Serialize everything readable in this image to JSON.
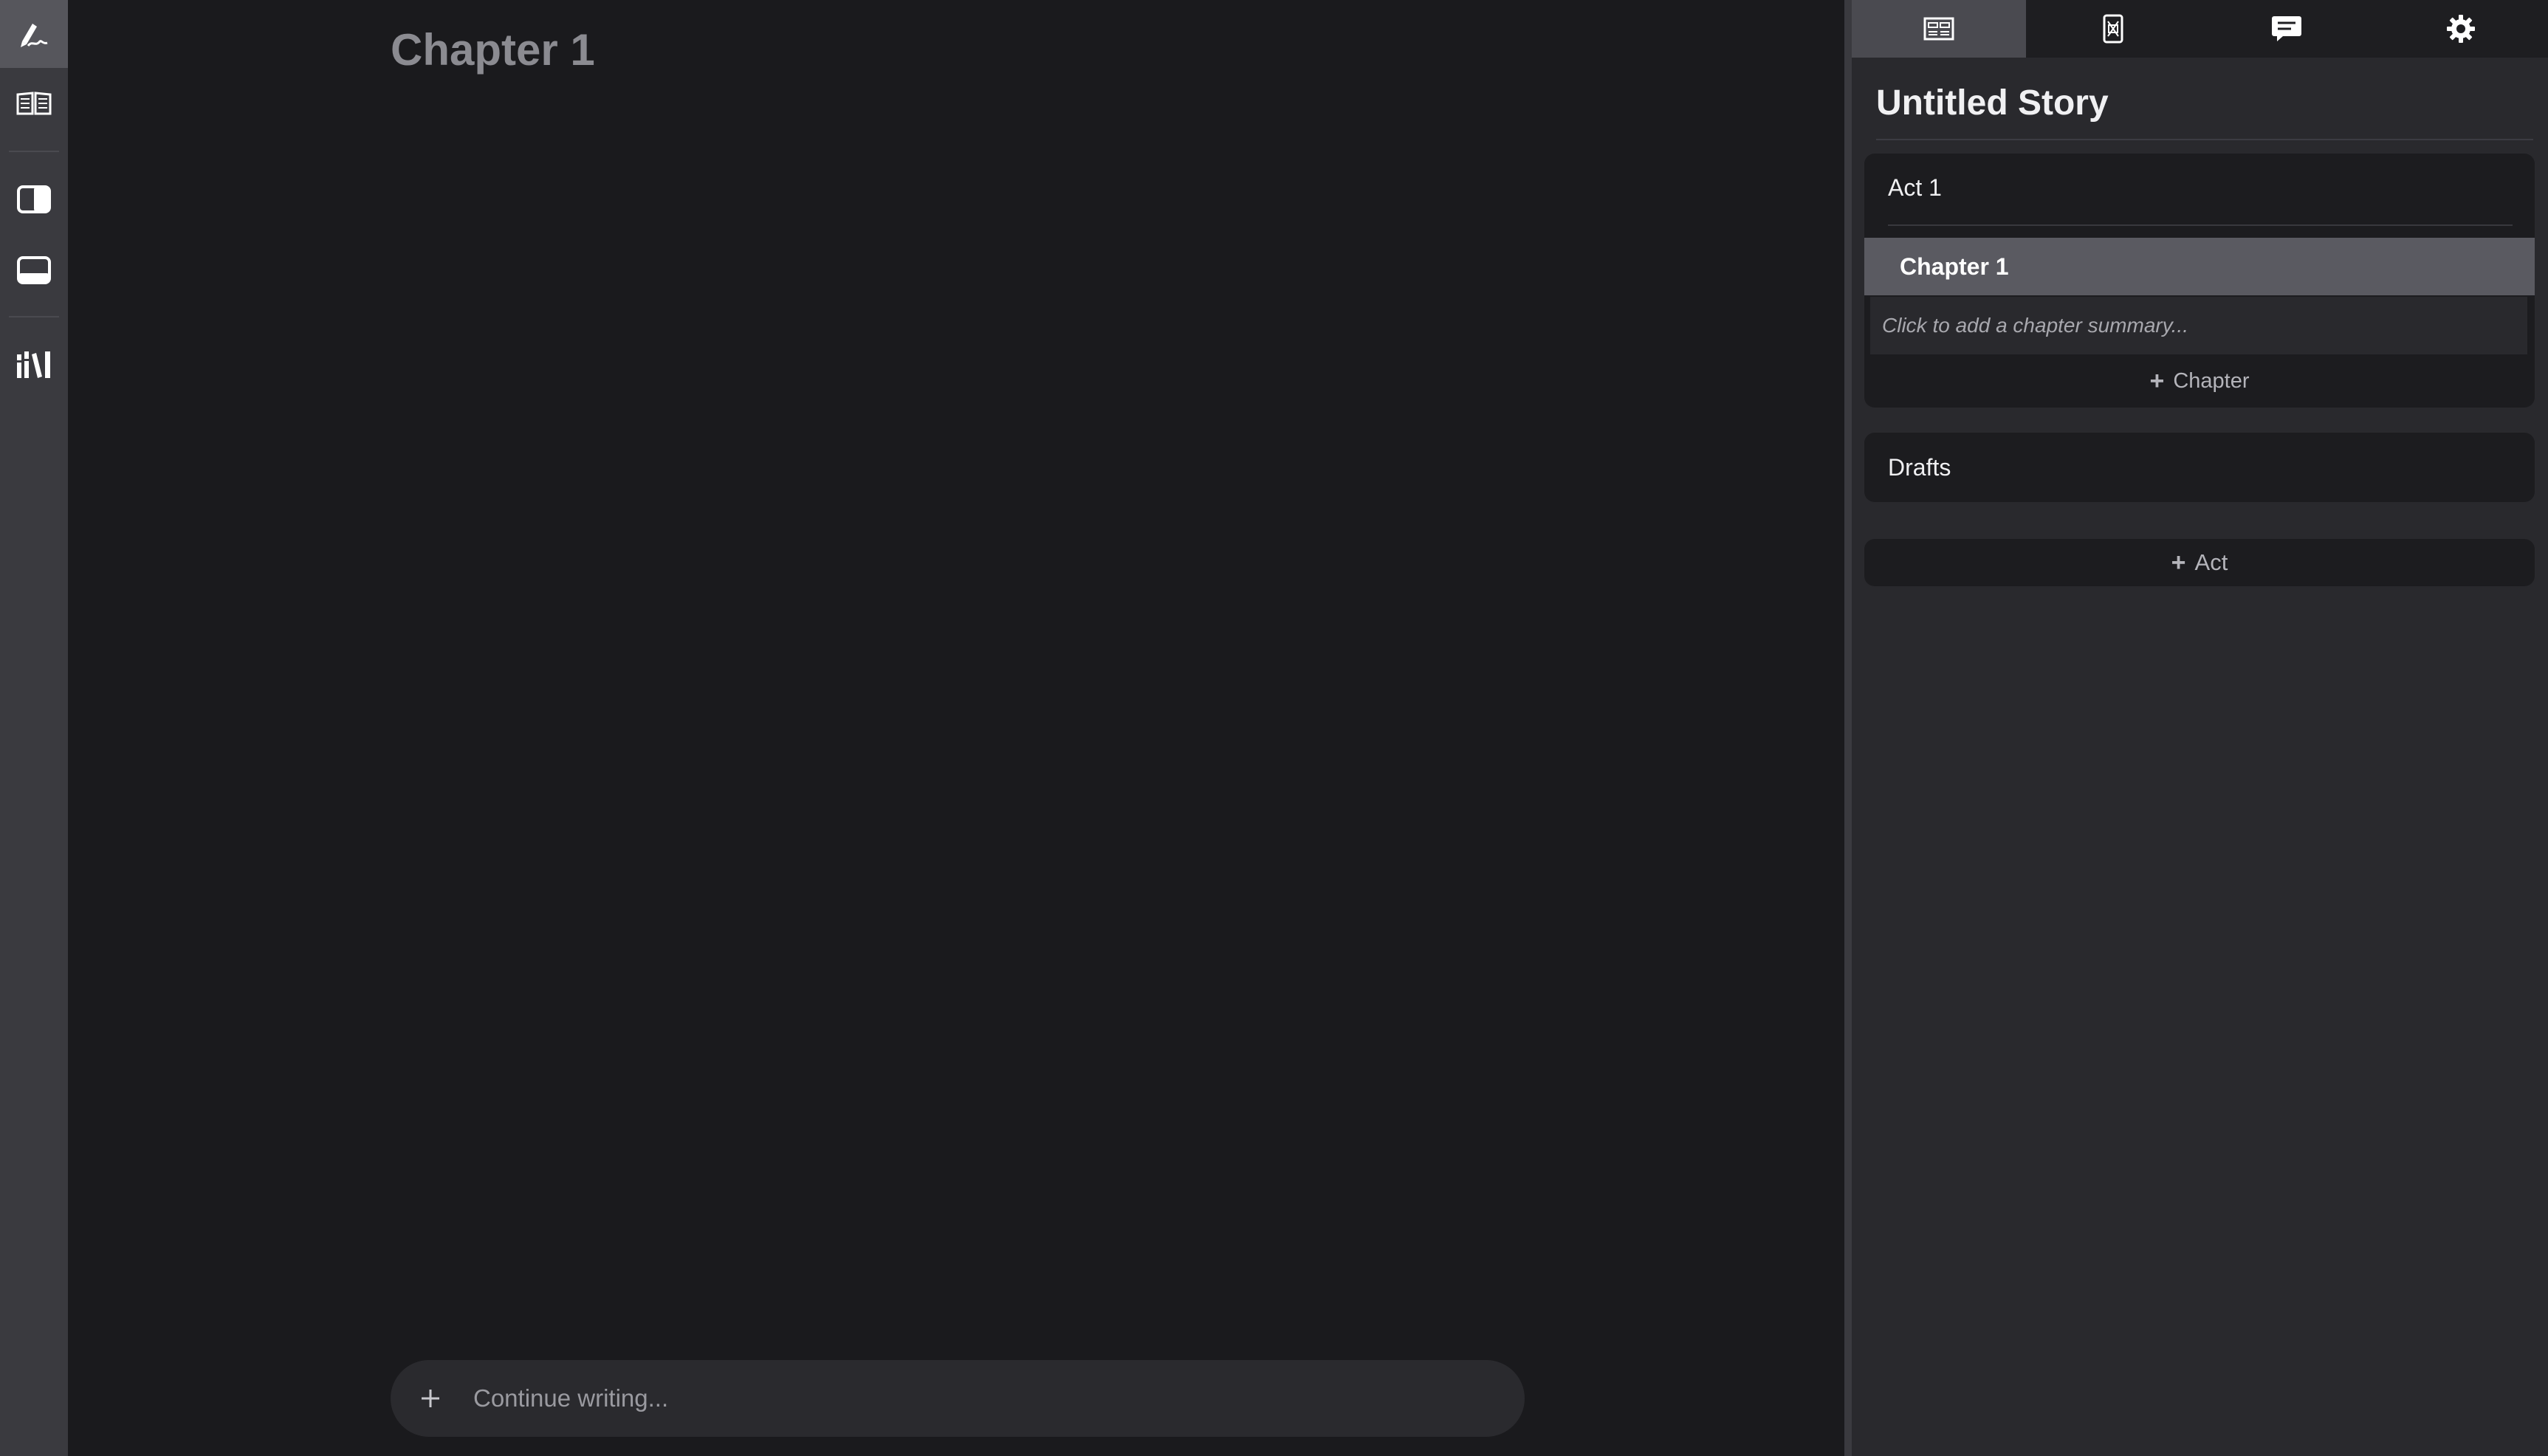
{
  "rail": {
    "items": [
      {
        "icon": "pen-nib-icon",
        "active": true
      },
      {
        "icon": "open-book-icon",
        "active": false
      },
      {
        "icon": "sidebar-right-icon",
        "active": false
      },
      {
        "icon": "panel-bottom-icon",
        "active": false
      },
      {
        "icon": "library-icon",
        "active": false
      }
    ]
  },
  "editor": {
    "chapter_heading": "Chapter 1",
    "continue_placeholder": "Continue writing..."
  },
  "panel": {
    "tabs": [
      {
        "icon": "outline-icon",
        "active": true
      },
      {
        "icon": "codex-icon",
        "active": false
      },
      {
        "icon": "chat-icon",
        "active": false
      },
      {
        "icon": "gear-icon",
        "active": false
      }
    ],
    "story_title": "Untitled Story",
    "acts": [
      {
        "title": "Act 1",
        "chapters": [
          {
            "title": "Chapter 1",
            "selected": true,
            "summary_placeholder": "Click to add a chapter summary..."
          }
        ],
        "add_chapter_label": "Chapter"
      }
    ],
    "drafts_label": "Drafts",
    "add_act_label": "Act"
  },
  "colors": {
    "background": "#1a1a1d",
    "rail": "#3a3a3f",
    "panel": "#29292d",
    "card": "#1c1c1f",
    "selected_row": "#5a5a61",
    "heading_muted": "#8b8b91"
  }
}
